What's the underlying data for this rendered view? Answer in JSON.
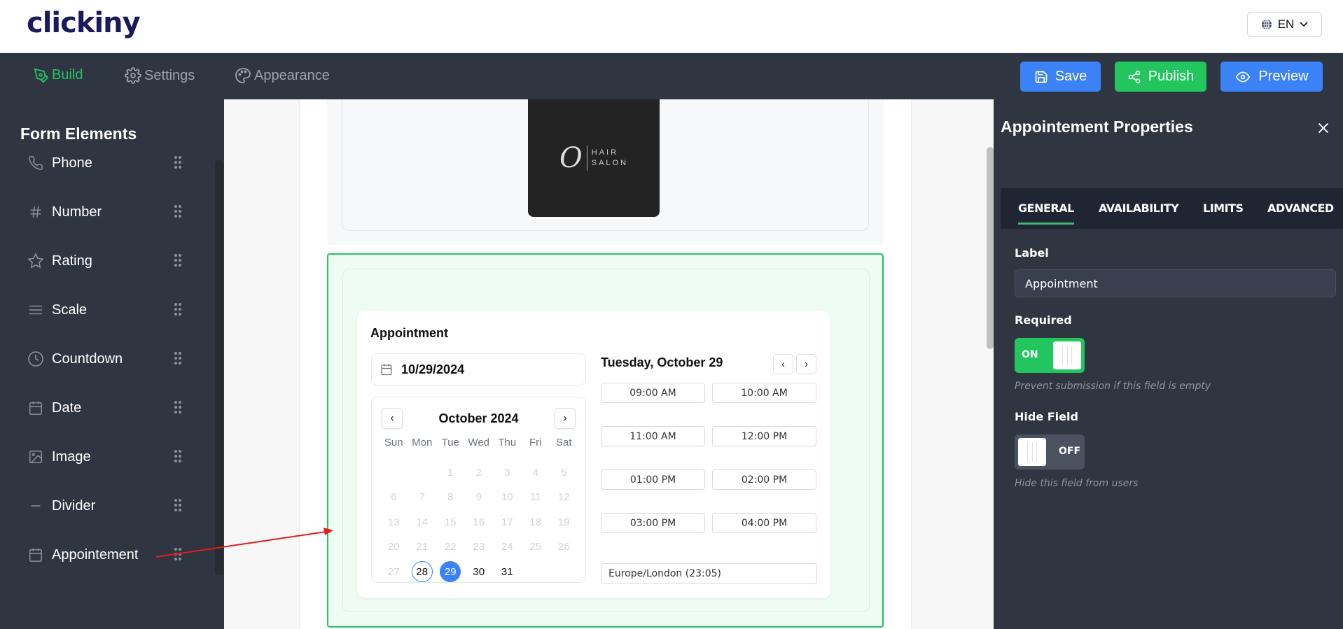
{
  "app": {
    "logo_text": "clickiny"
  },
  "language": {
    "selected": "EN",
    "icon": "globe-icon"
  },
  "nav": {
    "tabs": [
      {
        "label": "Build",
        "icon": "pen-tool-icon",
        "active": true
      },
      {
        "label": "Settings",
        "icon": "gear-icon",
        "active": false
      },
      {
        "label": "Appearance",
        "icon": "palette-icon",
        "active": false
      }
    ],
    "actions": {
      "save_label": "Save",
      "publish_label": "Publish",
      "preview_label": "Preview"
    }
  },
  "sidebar": {
    "title": "Form Elements",
    "items": [
      {
        "label": "Phone",
        "icon": "phone-icon"
      },
      {
        "label": "Number",
        "icon": "hash-icon"
      },
      {
        "label": "Rating",
        "icon": "star-icon"
      },
      {
        "label": "Scale",
        "icon": "menu-lines-icon"
      },
      {
        "label": "Countdown",
        "icon": "clock-icon"
      },
      {
        "label": "Date",
        "icon": "calendar-icon"
      },
      {
        "label": "Image",
        "icon": "image-icon"
      },
      {
        "label": "Divider",
        "icon": "minus-icon"
      },
      {
        "label": "Appointement",
        "icon": "calendar-icon"
      }
    ]
  },
  "canvas": {
    "image_block": {
      "logo_script": "O",
      "logo_line1": "HAIR",
      "logo_line2": "SALON"
    },
    "appointment": {
      "title": "Appointment",
      "date_value": "10/29/2024",
      "calendar": {
        "month_label": "October 2024",
        "weekdays": [
          "Sun",
          "Mon",
          "Tue",
          "Wed",
          "Thu",
          "Fri",
          "Sat"
        ],
        "leading_blanks": 2,
        "days": [
          "1",
          "2",
          "3",
          "4",
          "5",
          "6",
          "7",
          "8",
          "9",
          "10",
          "11",
          "12",
          "13",
          "14",
          "15",
          "16",
          "17",
          "18",
          "19",
          "20",
          "21",
          "22",
          "23",
          "24",
          "25",
          "26",
          "27",
          "28",
          "29",
          "30",
          "31"
        ],
        "today": "28",
        "selected": "29",
        "available_from": 28
      },
      "slots_title": "Tuesday, October 29",
      "slots": [
        "09:00 AM",
        "10:00 AM",
        "11:00 AM",
        "12:00 PM",
        "01:00 PM",
        "02:00 PM",
        "03:00 PM",
        "04:00 PM"
      ],
      "timezone": "Europe/London (23:05)"
    }
  },
  "properties": {
    "title": "Appointement Properties",
    "tabs": [
      {
        "label": "GENERAL",
        "active": true
      },
      {
        "label": "AVAILABILITY",
        "active": false
      },
      {
        "label": "LIMITS",
        "active": false
      },
      {
        "label": "ADVANCED",
        "active": false
      }
    ],
    "label_field": {
      "label": "Label",
      "value": "Appointment"
    },
    "required": {
      "label": "Required",
      "state": "ON",
      "hint": "Prevent submission if this field is empty"
    },
    "hide_field": {
      "label": "Hide Field",
      "state": "OFF",
      "hint": "Hide this field from users"
    }
  },
  "colors": {
    "accent_green": "#22c55e",
    "accent_blue": "#3b82f6",
    "dark_bg": "#2f3541",
    "annotation_arrow": "#e11d1d"
  }
}
